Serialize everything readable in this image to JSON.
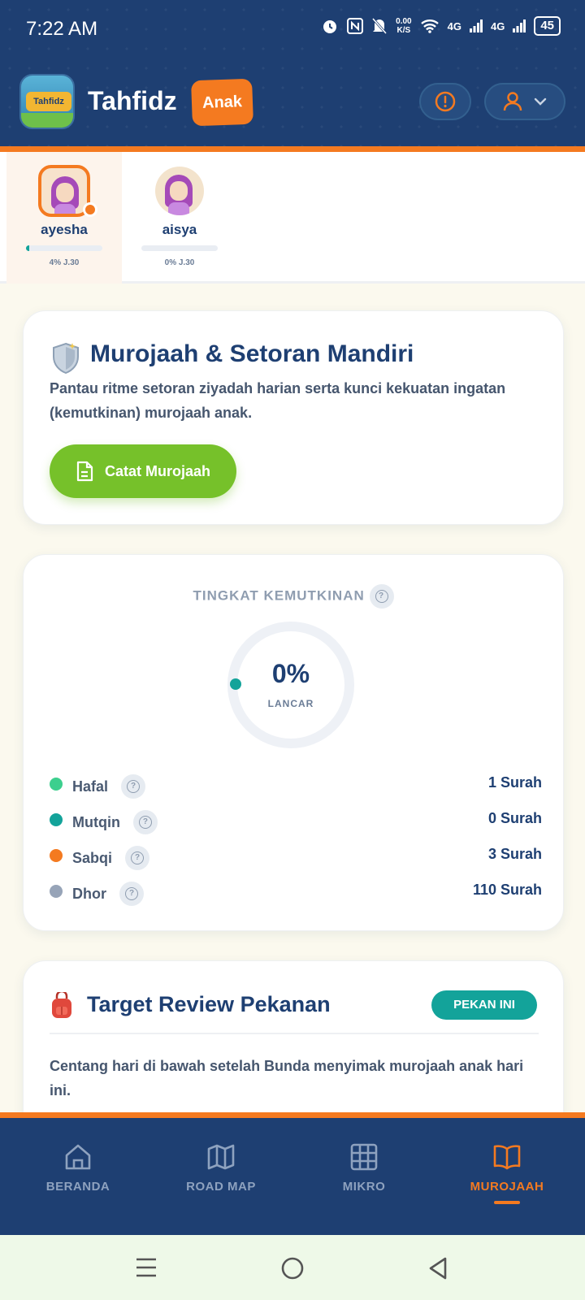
{
  "status_bar": {
    "time": "7:22 AM",
    "net_speed_value": "0.00",
    "net_speed_unit": "K/S",
    "signal1": "4G",
    "signal2": "4G",
    "battery": "45"
  },
  "header": {
    "app_name": "Tahfidz",
    "badge": "Anak",
    "logo_text": "Tahfidz"
  },
  "children": [
    {
      "name": "ayesha",
      "progress_text": "4% J.30",
      "progress_fraction": 0.04,
      "active": true
    },
    {
      "name": "aisya",
      "progress_text": "0% J.30",
      "progress_fraction": 0.0,
      "active": false
    }
  ],
  "murojaah_card": {
    "title": "Murojaah & Setoran Mandiri",
    "description": "Pantau ritme setoran ziyadah harian serta kunci kekuatan ingatan (kemutkinan) murojaah anak.",
    "button": "Catat Murojaah"
  },
  "kemutkinan_card": {
    "title": "TINGKAT KEMUTKINAN",
    "percent": "0%",
    "percent_label": "LANCAR",
    "legend": [
      {
        "label": "Hafal",
        "value": "1 Surah",
        "color": "#3ccf8e"
      },
      {
        "label": "Mutqin",
        "value": "0 Surah",
        "color": "#13a39a"
      },
      {
        "label": "Sabqi",
        "value": "3 Surah",
        "color": "#f47a20"
      },
      {
        "label": "Dhor",
        "value": "110 Surah",
        "color": "#97a4b8"
      }
    ]
  },
  "target_card": {
    "title": "Target Review Pekanan",
    "badge": "PEKAN INI",
    "description": "Centang hari di bawah setelah Bunda menyimak murojaah anak hari ini."
  },
  "bottom_nav": [
    {
      "label": "BERANDA",
      "icon": "home-icon",
      "active": false
    },
    {
      "label": "ROAD MAP",
      "icon": "map-icon",
      "active": false
    },
    {
      "label": "MIKRO",
      "icon": "grid-icon",
      "active": false
    },
    {
      "label": "MUROJAAH",
      "icon": "book-icon",
      "active": true
    }
  ],
  "colors": {
    "primary": "#1e3f72",
    "accent": "#f47a20",
    "green": "#76c12a",
    "teal": "#13a39a"
  }
}
